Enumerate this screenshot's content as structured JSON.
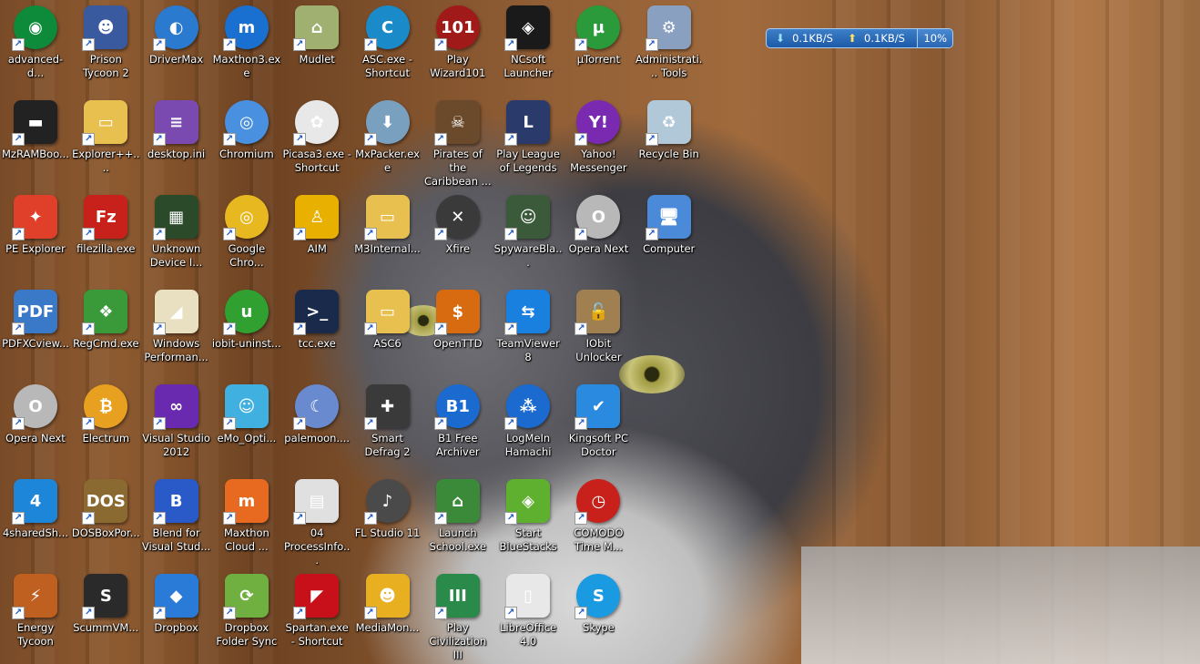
{
  "netmeter": {
    "download": "0.1KB/S",
    "upload": "0.1KB/S",
    "percent": "10%"
  },
  "columns": [
    [
      {
        "name": "advanced-d...",
        "icon": "advanced-systemcare-icon",
        "color": "#0d8a3a",
        "glyph": "◉",
        "round": true
      },
      {
        "name": "MzRAMBoo...",
        "icon": "mzramboost-icon",
        "color": "#222222",
        "glyph": "▬"
      },
      {
        "name": "PE Explorer",
        "icon": "pe-explorer-icon",
        "color": "#e0402a",
        "glyph": "✦"
      },
      {
        "name": "PDFXCview...",
        "icon": "pdf-xchange-viewer-icon",
        "color": "#3a78c8",
        "glyph": "PDF"
      },
      {
        "name": "Opera Next",
        "icon": "opera-icon",
        "color": "#b8b8b8",
        "glyph": "O",
        "round": true
      },
      {
        "name": "4sharedSh...",
        "icon": "4shared-icon",
        "color": "#1e86d8",
        "glyph": "4"
      },
      {
        "name": "Energy Tycoon",
        "icon": "energy-tycoon-icon",
        "color": "#c06020",
        "glyph": "⚡"
      }
    ],
    [
      {
        "name": "Prison Tycoon 2",
        "icon": "prison-tycoon-icon",
        "color": "#3a5aa0",
        "glyph": "☻"
      },
      {
        "name": "Explorer++....",
        "icon": "folder-icon",
        "color": "#e8c050",
        "glyph": "▭"
      },
      {
        "name": "filezilla.exe",
        "icon": "filezilla-icon",
        "color": "#c8201a",
        "glyph": "Fz"
      },
      {
        "name": "RegCmd.exe",
        "icon": "regcmd-icon",
        "color": "#3a9a3a",
        "glyph": "❖"
      },
      {
        "name": "Electrum",
        "icon": "bitcoin-icon",
        "color": "#e8a020",
        "glyph": "₿",
        "round": true
      },
      {
        "name": "DOSBoxPor...",
        "icon": "dosbox-icon",
        "color": "#8a6a30",
        "glyph": "DOS"
      },
      {
        "name": "ScummVM...",
        "icon": "scummvm-icon",
        "color": "#2a2a2a",
        "glyph": "S"
      }
    ],
    [
      {
        "name": "DriverMax",
        "icon": "drivermax-icon",
        "color": "#2a7ad0",
        "glyph": "◐",
        "round": true
      },
      {
        "name": "desktop.ini",
        "icon": "notebook-icon",
        "color": "#7a4ab0",
        "glyph": "≡"
      },
      {
        "name": "Unknown Device I...",
        "icon": "circuit-board-icon",
        "color": "#2a4a2a",
        "glyph": "▦"
      },
      {
        "name": "Windows Performan...",
        "icon": "windows-performance-icon",
        "color": "#e8e0c0",
        "glyph": "◢"
      },
      {
        "name": "Visual Studio 2012",
        "icon": "visual-studio-icon",
        "color": "#6a2ab0",
        "glyph": "∞"
      },
      {
        "name": "Blend for Visual Stud...",
        "icon": "blend-icon",
        "color": "#2a5ac8",
        "glyph": "B"
      },
      {
        "name": "Dropbox",
        "icon": "dropbox-icon",
        "color": "#2a7ad8",
        "glyph": "◆"
      }
    ],
    [
      {
        "name": "Maxthon3.exe",
        "icon": "maxthon-icon",
        "color": "#1a70d0",
        "glyph": "m",
        "round": true
      },
      {
        "name": "Chromium",
        "icon": "chromium-icon",
        "color": "#4a90e0",
        "glyph": "◎",
        "round": true
      },
      {
        "name": "Google Chro...",
        "icon": "chrome-icon",
        "color": "#e8b820",
        "glyph": "◎",
        "round": true
      },
      {
        "name": "iobit-uninst...",
        "icon": "iobit-uninstaller-icon",
        "color": "#30a030",
        "glyph": "u",
        "round": true
      },
      {
        "name": "eMo_Opti...",
        "icon": "emo-robot-icon",
        "color": "#40b0e0",
        "glyph": "☺"
      },
      {
        "name": "Maxthon Cloud ...",
        "icon": "maxthon-cloud-icon",
        "color": "#e86a20",
        "glyph": "m"
      },
      {
        "name": "Dropbox Folder Sync",
        "icon": "dropbox-folder-sync-icon",
        "color": "#70b040",
        "glyph": "⟳"
      }
    ],
    [
      {
        "name": "Mudlet",
        "icon": "mudlet-icon",
        "color": "#a0b070",
        "glyph": "⌂"
      },
      {
        "name": "Picasa3.exe - Shortcut",
        "icon": "picasa-icon",
        "color": "#e8e8e8",
        "glyph": "✿",
        "round": true
      },
      {
        "name": "AIM",
        "icon": "aim-icon",
        "color": "#e8b000",
        "glyph": "♙"
      },
      {
        "name": "tcc.exe",
        "icon": "console-icon",
        "color": "#1a2a4a",
        "glyph": ">_"
      },
      {
        "name": "palemoon....",
        "icon": "palemoon-icon",
        "color": "#6a8ad0",
        "glyph": "☾",
        "round": true
      },
      {
        "name": "04 ProcessInfo...",
        "icon": "process-info-icon",
        "color": "#e0e0e0",
        "glyph": "▤"
      },
      {
        "name": "Spartan.exe - Shortcut",
        "icon": "spartan-icon",
        "color": "#c8101a",
        "glyph": "◤"
      }
    ],
    [
      {
        "name": "ASC.exe - Shortcut",
        "icon": "asc-icon",
        "color": "#1a8ac8",
        "glyph": "C",
        "round": true
      },
      {
        "name": "MxPacker.exe",
        "icon": "mxpacker-icon",
        "color": "#7aa0c0",
        "glyph": "⬇",
        "round": true
      },
      {
        "name": "M3Internal...",
        "icon": "folder-icon",
        "color": "#e8c050",
        "glyph": "▭"
      },
      {
        "name": "ASC6",
        "icon": "folder-icon",
        "color": "#e8c050",
        "glyph": "▭"
      },
      {
        "name": "Smart Defrag 2",
        "icon": "smart-defrag-icon",
        "color": "#3a3a3a",
        "glyph": "✚"
      },
      {
        "name": "FL Studio 11",
        "icon": "fl-studio-icon",
        "color": "#4a4a4a",
        "glyph": "♪",
        "round": true
      },
      {
        "name": "MediaMon...",
        "icon": "mediamonkey-icon",
        "color": "#e8b020",
        "glyph": "☻"
      }
    ],
    [
      {
        "name": "Play Wizard101",
        "icon": "wizard101-icon",
        "color": "#a01a1a",
        "glyph": "101",
        "round": true
      },
      {
        "name": "Pirates of the Caribbean ...",
        "icon": "pirates-skull-icon",
        "color": "#6a4a2a",
        "glyph": "☠"
      },
      {
        "name": "Xfire",
        "icon": "xfire-icon",
        "color": "#3a3a3a",
        "glyph": "✕",
        "round": true
      },
      {
        "name": "OpenTTD",
        "icon": "openttd-icon",
        "color": "#d86a10",
        "glyph": "$"
      },
      {
        "name": "B1 Free Archiver",
        "icon": "b1-archiver-icon",
        "color": "#1a6ad0",
        "glyph": "B1",
        "round": true
      },
      {
        "name": "Launch School.exe",
        "icon": "school-building-icon",
        "color": "#3a8a3a",
        "glyph": "⌂"
      },
      {
        "name": "Play Civilization III",
        "icon": "civilization-icon",
        "color": "#2a8a4a",
        "glyph": "III"
      }
    ],
    [
      {
        "name": "NCsoft Launcher",
        "icon": "ncsoft-icon",
        "color": "#1a1a1a",
        "glyph": "◈"
      },
      {
        "name": "Play League of Legends",
        "icon": "league-of-legends-icon",
        "color": "#2a3a6a",
        "glyph": "L"
      },
      {
        "name": "SpywareBla...",
        "icon": "spywareblaster-icon",
        "color": "#3a5a3a",
        "glyph": "☺"
      },
      {
        "name": "TeamViewer 8",
        "icon": "teamviewer-icon",
        "color": "#1a80e0",
        "glyph": "⇆"
      },
      {
        "name": "LogMeIn Hamachi",
        "icon": "hamachi-icon",
        "color": "#1a6ad0",
        "glyph": "⁂",
        "round": true
      },
      {
        "name": "Start BlueStacks",
        "icon": "bluestacks-icon",
        "color": "#60b030",
        "glyph": "◈"
      },
      {
        "name": "LibreOffice 4.0",
        "icon": "libreoffice-icon",
        "color": "#e8e8e8",
        "glyph": "▯"
      }
    ],
    [
      {
        "name": "µTorrent",
        "icon": "utorrent-icon",
        "color": "#2a9a3a",
        "glyph": "µ",
        "round": true
      },
      {
        "name": "Yahoo! Messenger",
        "icon": "yahoo-messenger-icon",
        "color": "#7a2ab0",
        "glyph": "Y!",
        "round": true
      },
      {
        "name": "Opera Next",
        "icon": "opera-icon",
        "color": "#b8b8b8",
        "glyph": "O",
        "round": true
      },
      {
        "name": "IObit Unlocker",
        "icon": "unlock-icon",
        "color": "#a08050",
        "glyph": "🔓"
      },
      {
        "name": "Kingsoft PC Doctor",
        "icon": "kingsoft-shield-icon",
        "color": "#2a8ae0",
        "glyph": "✔"
      },
      {
        "name": "COMODO Time M...",
        "icon": "comodo-time-machine-icon",
        "color": "#c8201a",
        "glyph": "◷",
        "round": true
      },
      {
        "name": "Skype",
        "icon": "skype-icon",
        "color": "#1a9ae0",
        "glyph": "S",
        "round": true
      }
    ],
    [
      {
        "name": "Administrati... Tools",
        "icon": "administrative-tools-icon",
        "color": "#8aa0c0",
        "glyph": "⚙"
      },
      {
        "name": "Recycle Bin",
        "icon": "recycle-bin-icon",
        "color": "#b0c8d8",
        "glyph": "♻"
      },
      {
        "name": "Computer",
        "icon": "computer-icon",
        "color": "#4a8ad8",
        "glyph": "🖥"
      }
    ]
  ]
}
